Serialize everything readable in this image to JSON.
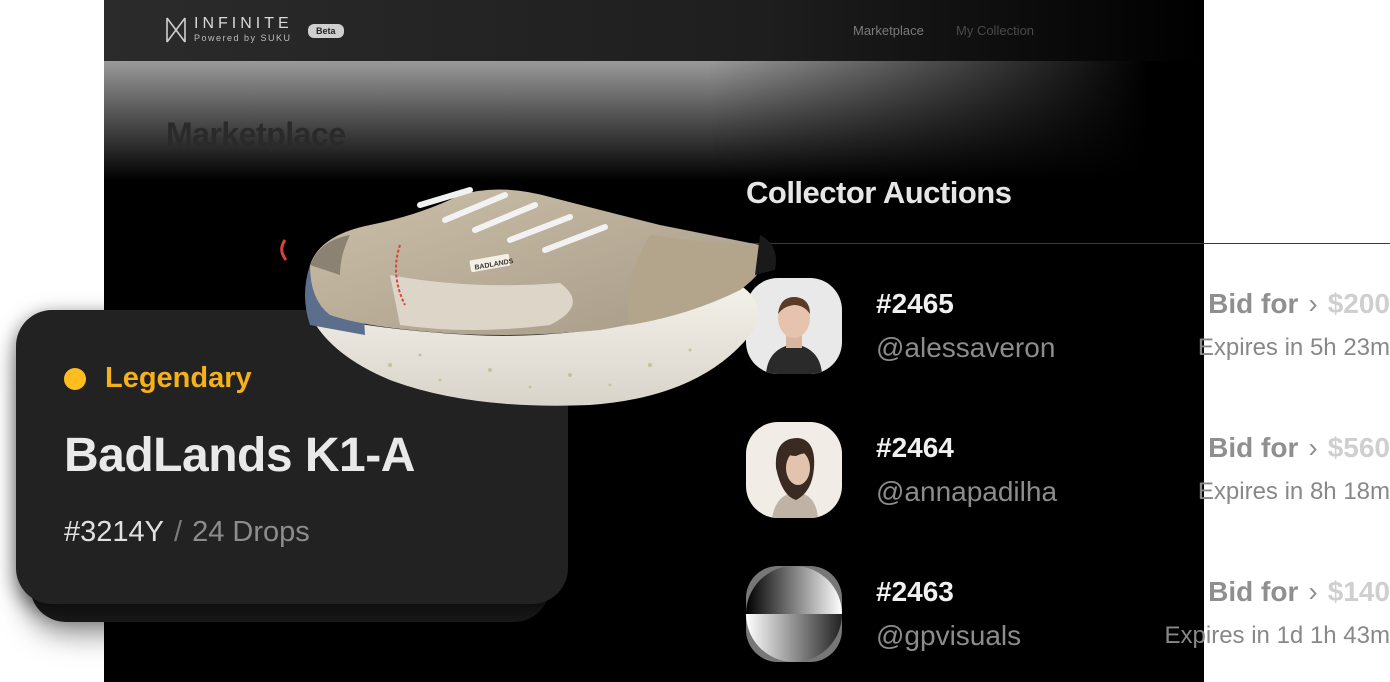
{
  "app": {
    "brand_name": "INFINITE",
    "brand_sub": "Powered by SUKU",
    "beta_badge": "Beta",
    "nav": {
      "marketplace": "Marketplace",
      "my_collection": "My Collection"
    },
    "page_title": "Marketplace"
  },
  "auctions": {
    "title": "Collector Auctions",
    "rows": [
      {
        "lot": "#2465",
        "handle": "@alessaveron",
        "bid_label": "Bid for",
        "price": "$200",
        "expires": "Expires in 5h 23m",
        "avatar": "person-portrait-male"
      },
      {
        "lot": "#2464",
        "handle": "@annapadilha",
        "bid_label": "Bid for",
        "price": "$560",
        "expires": "Expires in 8h 18m",
        "avatar": "person-portrait-female"
      },
      {
        "lot": "#2463",
        "handle": "@gpvisuals",
        "bid_label": "Bid for",
        "price": "$140",
        "expires": "Expires in 1d 1h 43m",
        "avatar": "gradient-abstract"
      }
    ]
  },
  "card": {
    "rarity": "Legendary",
    "rarity_color": "#ffbd1f",
    "title": "BadLands K1-A",
    "id": "#3214Y",
    "separator": "/",
    "drops": "24 Drops"
  },
  "shoe": {
    "brand_tag": "BADLANDS"
  }
}
